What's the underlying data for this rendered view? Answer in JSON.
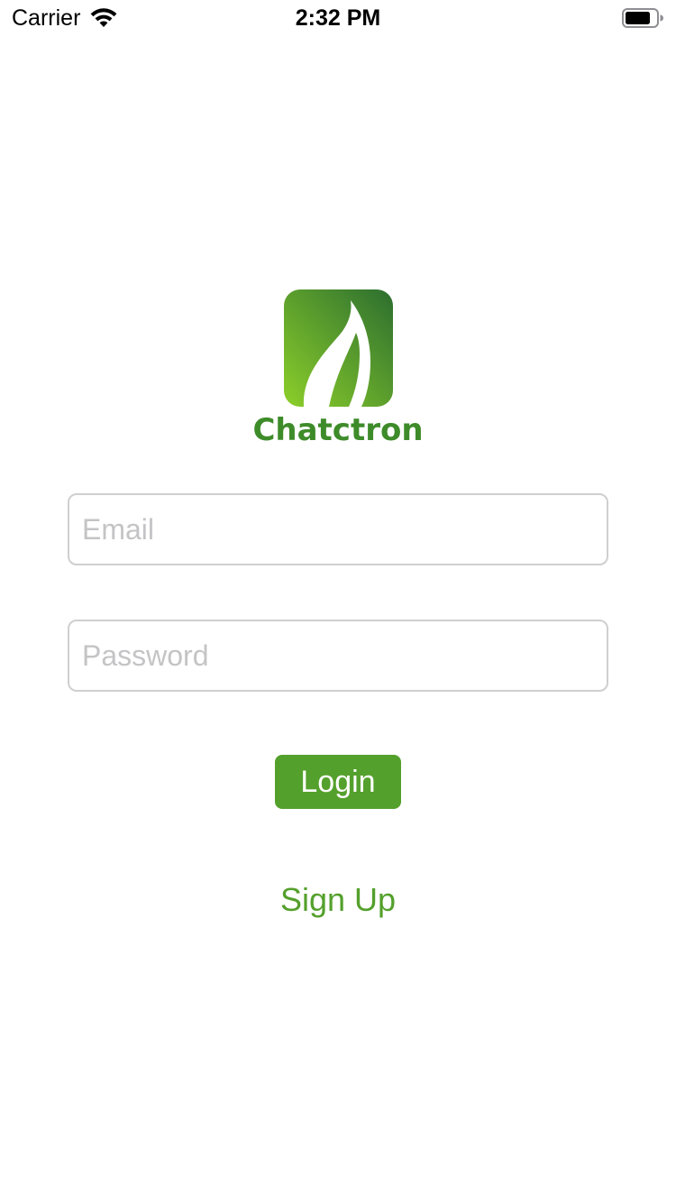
{
  "status_bar": {
    "carrier": "Carrier",
    "time": "2:32 PM",
    "icons": {
      "wifi": "wifi-icon",
      "battery": "battery-icon"
    }
  },
  "logo": {
    "icon": "leaf-logo-icon",
    "app_name": "Chatctron",
    "colors": {
      "gradient_light": "#8ccf2a",
      "gradient_dark": "#2c6e2f",
      "text": "#3e8b2a"
    }
  },
  "form": {
    "email": {
      "value": "",
      "placeholder": "Email"
    },
    "password": {
      "value": "",
      "placeholder": "Password"
    },
    "login_label": "Login",
    "signup_label": "Sign Up"
  },
  "colors": {
    "accent": "#54a02c",
    "field_border": "#cfcfcf",
    "placeholder": "#c4c4c6"
  }
}
